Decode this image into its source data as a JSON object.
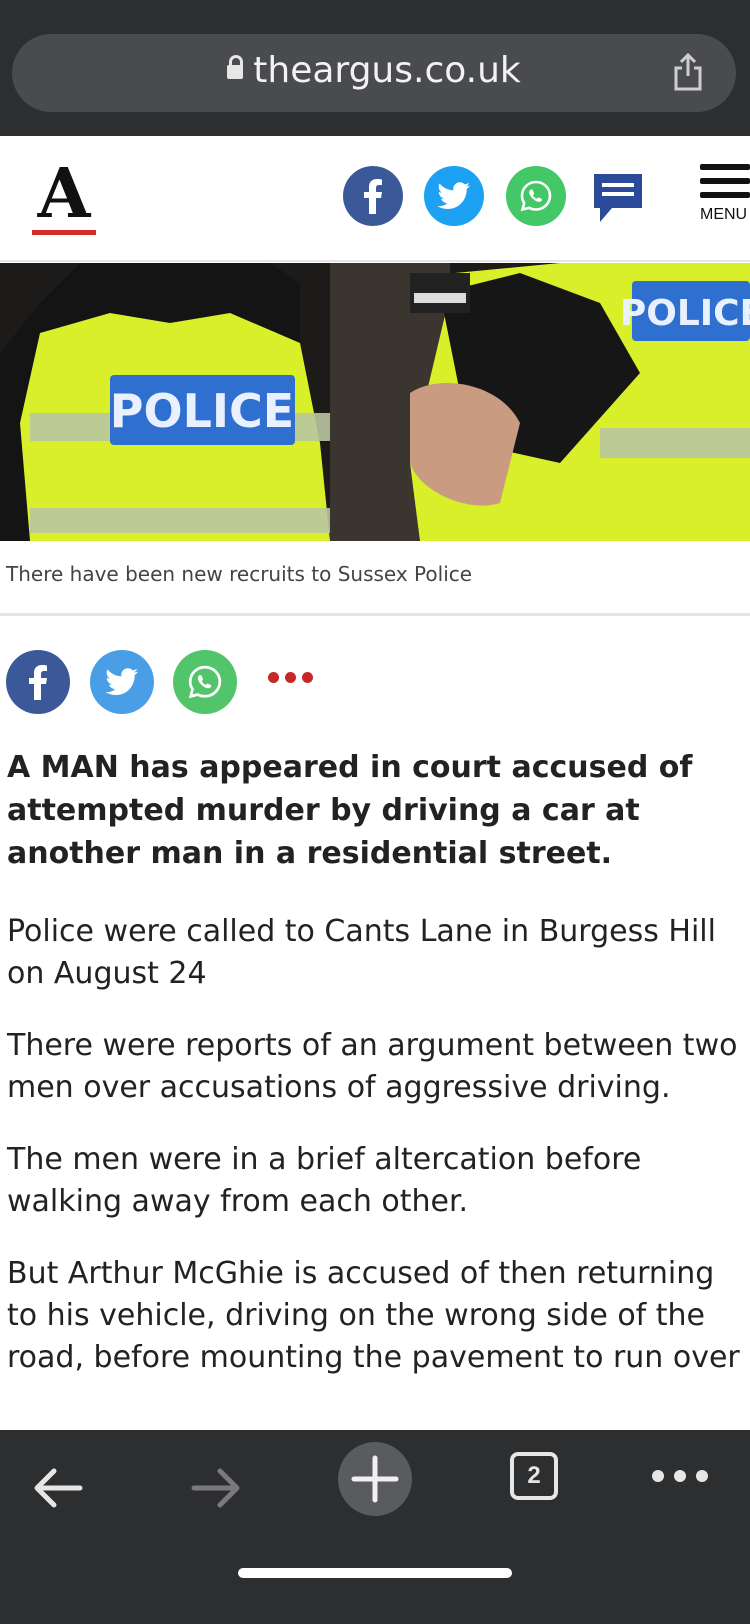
{
  "browser": {
    "url": "theargus.co.uk"
  },
  "header": {
    "logo_text": "A",
    "menu_label": "MENU"
  },
  "hero": {
    "vest_text_left": "POLICE",
    "vest_text_right": "POLICE",
    "caption": "There have been new recruits to Sussex Police"
  },
  "article": {
    "lead": "A MAN has appeared in court accused of attempted murder by driving a car at another man in a residential street.",
    "paragraphs": [
      [
        "Police were called to Cants Lane in Burgess Hill",
        "on August 24"
      ],
      [
        "There were reports of an argument between two",
        "men over accusations of aggressive driving."
      ],
      [
        "The men were in a brief altercation before",
        "walking away from each other."
      ],
      [
        "But Arthur McGhie is accused of then returning",
        "to his vehicle, driving on the wrong side of the",
        "road, before mounting the pavement to run over"
      ]
    ]
  },
  "toolbar": {
    "tab_count": "2"
  },
  "colors": {
    "facebook": "#3b5998",
    "twitter": "#1da1f2",
    "whatsapp": "#44c767",
    "comment": "#2c4a9a",
    "logo_underline": "#d62b2b",
    "more_dots": "#c62828",
    "browser_chrome": "#2d2e30"
  },
  "icons": [
    "lock-icon",
    "share-icon",
    "facebook-icon",
    "twitter-icon",
    "whatsapp-icon",
    "comment-icon",
    "menu-icon",
    "more-icon",
    "back-icon",
    "forward-icon",
    "new-tab-icon",
    "tabs-icon",
    "overflow-icon"
  ]
}
